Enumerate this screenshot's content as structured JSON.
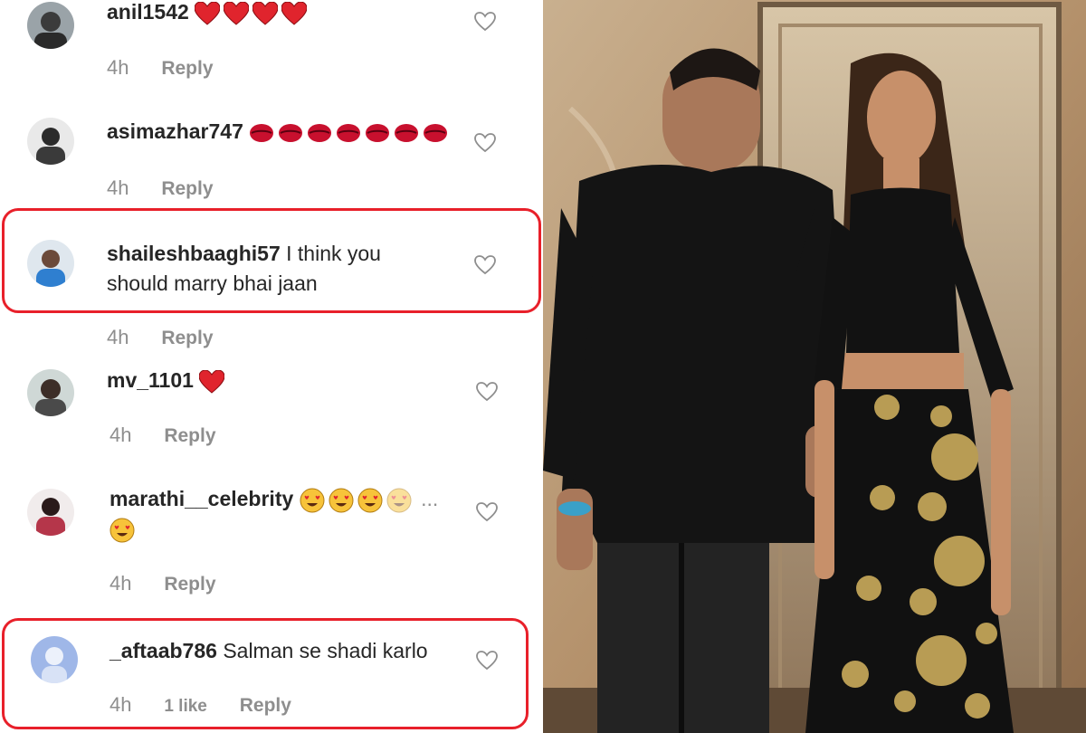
{
  "comments": [
    {
      "username": "anil1542",
      "text": "",
      "emoji": "heart-emoji",
      "emoji_count": 4,
      "time": "4h",
      "likes": "",
      "reply": "Reply"
    },
    {
      "username": "asimazhar747",
      "text": "",
      "emoji": "lips-emoji",
      "emoji_count": 7,
      "time": "4h",
      "likes": "",
      "reply": "Reply"
    },
    {
      "username": "shaileshbaaghi57",
      "text": "I think you",
      "text2": "should marry bhai jaan",
      "time": "4h",
      "likes": "",
      "reply": "Reply"
    },
    {
      "username": "mv_1101",
      "text": "",
      "emoji": "heart-emoji",
      "emoji_count": 1,
      "time": "4h",
      "likes": "",
      "reply": "Reply"
    },
    {
      "username": "marathi__celebrity",
      "text": "",
      "ellipsis": "...",
      "emoji": "heart-eyes-emoji",
      "emoji_count": 5,
      "time": "4h",
      "likes": "",
      "reply": "Reply"
    },
    {
      "username": "_aftaab786",
      "text": "Salman se shadi karlo",
      "time": "4h",
      "likes": "1 like",
      "reply": "Reply"
    }
  ],
  "colors": {
    "highlight": "#e8202a",
    "username": "#262626",
    "meta": "#8e8e8e",
    "heart_emoji": "#e0242d",
    "lips_emoji": "#c8102e"
  },
  "icons": [
    "like-heart-outline-icon",
    "heart-emoji",
    "lips-emoji",
    "heart-eyes-emoji"
  ],
  "photo": {
    "description_icon": "event-photo"
  }
}
